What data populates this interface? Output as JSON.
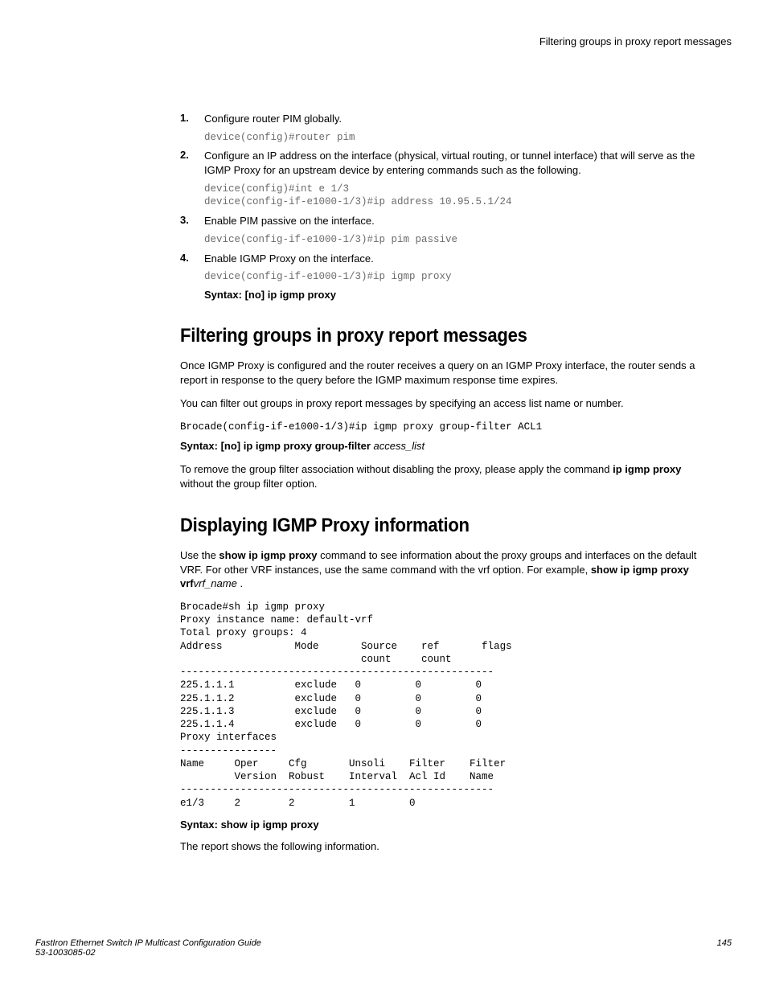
{
  "header": {
    "right": "Filtering groups in proxy report messages"
  },
  "steps": [
    {
      "num": "1.",
      "text": "Configure router PIM globally.",
      "code": "device(config)#router pim"
    },
    {
      "num": "2.",
      "text": "Configure an IP address on the interface (physical, virtual routing, or tunnel interface) that will serve as the IGMP Proxy for an upstream device by entering commands such as the following.",
      "code": "device(config)#int e 1/3\ndevice(config-if-e1000-1/3)#ip address 10.95.5.1/24"
    },
    {
      "num": "3.",
      "text": "Enable PIM passive on the interface.",
      "code": "device(config-if-e1000-1/3)#ip pim passive"
    },
    {
      "num": "4.",
      "text": "Enable IGMP Proxy on the interface.",
      "code": "device(config-if-e1000-1/3)#ip igmp proxy"
    }
  ],
  "syntax1": "Syntax: [no] ip igmp proxy",
  "sec1": {
    "title": "Filtering groups in proxy report messages",
    "p1": "Once IGMP Proxy is configured and the router receives a query on an IGMP Proxy interface, the router sends a report in response to the query before the IGMP maximum response time expires.",
    "p2": "You can filter out groups in proxy report messages by specifying an access list name or number.",
    "code": "Brocade(config-if-e1000-1/3)#ip igmp proxy group-filter ACL1",
    "syntax_bold": "Syntax: [no] ip igmp proxy group-filter ",
    "syntax_ital": "access_list",
    "p3a": "To remove the group filter association without disabling the proxy, please apply the command ",
    "p3b": "ip igmp proxy",
    "p3c": " without the group filter option."
  },
  "sec2": {
    "title": "Displaying IGMP Proxy information",
    "p1a": "Use the ",
    "p1b": "show ip igmp proxy",
    "p1c": " command to see information about the proxy groups and interfaces on the default VRF. For other VRF instances, use the same command with the vrf option. For example, ",
    "p1d": "show ip igmp proxy vrf",
    "p1e": "vrf_name",
    "p1f": " .",
    "output": "Brocade#sh ip igmp proxy\nProxy instance name: default-vrf\nTotal proxy groups: 4\nAddress            Mode       Source    ref       flags\n                              count     count\n----------------------------------------------------\n225.1.1.1          exclude   0         0         0\n225.1.1.2          exclude   0         0         0\n225.1.1.3          exclude   0         0         0\n225.1.1.4          exclude   0         0         0\nProxy interfaces\n----------------\nName     Oper     Cfg       Unsoli    Filter    Filter\n         Version  Robust    Interval  Acl Id    Name\n----------------------------------------------------\ne1/3     2        2         1         0",
    "syntax": "Syntax: show ip igmp proxy",
    "p2": "The report shows the following information."
  },
  "footer": {
    "title": "FastIron Ethernet Switch IP Multicast Configuration Guide",
    "docnum": "53-1003085-02",
    "page": "145"
  }
}
